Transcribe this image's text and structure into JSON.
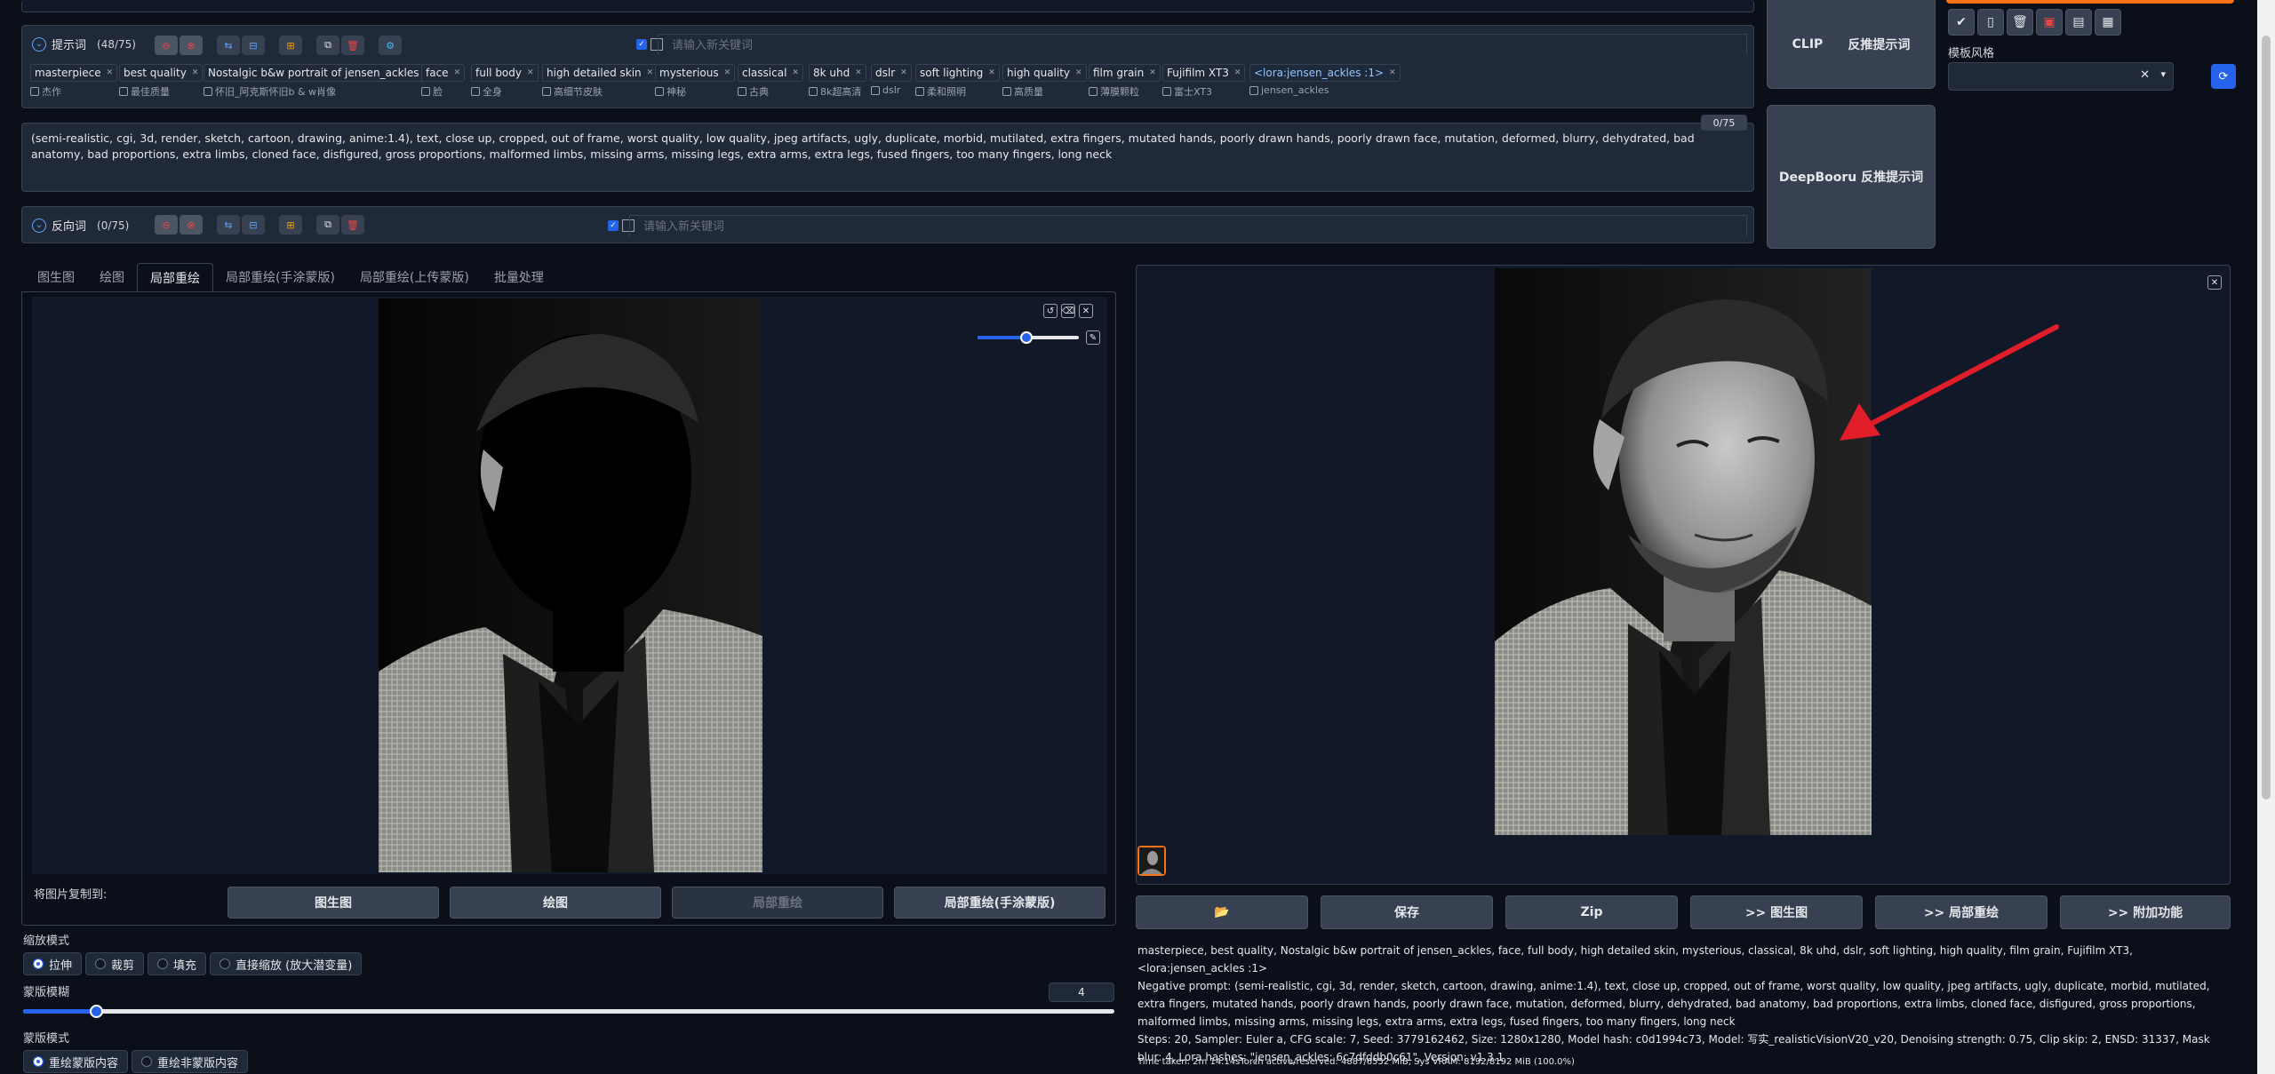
{
  "prompt": {
    "title": "提示词",
    "count": "(48/75)",
    "keyword_placeholder": "请输入新关键词",
    "tags": [
      {
        "en": "masterpiece",
        "zh": "杰作"
      },
      {
        "en": "best quality",
        "zh": "最佳质量"
      },
      {
        "en": "Nostalgic b&w portrait of jensen_ackles",
        "zh": "怀旧_阿克斯怀旧b & w肖像"
      },
      {
        "en": "face",
        "zh": "脸"
      },
      {
        "en": "full body",
        "zh": "全身"
      },
      {
        "en": "high detailed skin",
        "zh": "高细节皮肤"
      },
      {
        "en": "mysterious",
        "zh": "神秘"
      },
      {
        "en": "classical",
        "zh": "古典"
      },
      {
        "en": "8k uhd",
        "zh": "8k超高清"
      },
      {
        "en": "dslr",
        "zh": "dslr"
      },
      {
        "en": "soft lighting",
        "zh": "柔和照明"
      },
      {
        "en": "high quality",
        "zh": "高质量"
      },
      {
        "en": "film grain",
        "zh": "薄膜颗粒"
      },
      {
        "en": "Fujifilm XT3",
        "zh": "富士XT3"
      },
      {
        "en": "<lora:jensen_ackles :1>",
        "zh": "jensen_ackles"
      }
    ]
  },
  "negative": {
    "text": "(semi-realistic, cgi, 3d, render, sketch, cartoon, drawing, anime:1.4), text, close up, cropped, out of frame, worst quality, low quality, jpeg artifacts, ugly, duplicate, morbid, mutilated, extra fingers, mutated hands, poorly drawn hands, poorly drawn face, mutation, deformed, blurry, dehydrated, bad anatomy, bad proportions, extra limbs, cloned face, disfigured, gross proportions, malformed limbs, missing arms, missing legs, extra arms, extra legs, fused fingers, too many fingers, long neck",
    "counter": "0/75",
    "title": "反向词",
    "count": "(0/75)",
    "keyword_placeholder": "请输入新关键词"
  },
  "tabs": [
    "图生图",
    "绘图",
    "局部重绘",
    "局部重绘(手涂蒙版)",
    "局部重绘(上传蒙版)",
    "批量处理"
  ],
  "copy_to": {
    "label": "将图片复制到:",
    "buttons": [
      "图生图",
      "绘图",
      "局部重绘",
      "局部重绘(手涂蒙版)"
    ]
  },
  "resize_mode": {
    "label": "缩放模式",
    "options": [
      "拉伸",
      "裁剪",
      "填充",
      "直接缩放 (放大潜变量)"
    ],
    "selected": "拉伸"
  },
  "mask_blur": {
    "label": "蒙版模糊",
    "value": "4",
    "fraction": 0.067
  },
  "mask_mode": {
    "label": "蒙版模式",
    "options": [
      "重绘蒙版内容",
      "重绘非蒙版内容"
    ],
    "selected": "重绘蒙版内容"
  },
  "side": {
    "clip_label": "CLIP",
    "clip_reverse": "反推提示词",
    "deepbooru": "DeepBooru 反推提示词",
    "style_label": "模板风格"
  },
  "output": {
    "buttons": [
      "📂",
      "保存",
      "Zip",
      ">> 图生图",
      ">> 局部重绘",
      ">> 附加功能"
    ],
    "info_prompt": "masterpiece, best quality, Nostalgic b&w portrait of jensen_ackles, face, full body, high detailed skin, mysterious, classical, 8k uhd, dslr, soft lighting, high quality, film grain, Fujifilm XT3, <lora:jensen_ackles :1>",
    "info_negative": "Negative prompt: (semi-realistic, cgi, 3d, render, sketch, cartoon, drawing, anime:1.4), text, close up, cropped, out of frame, worst quality, low quality, jpeg artifacts, ugly, duplicate, morbid, mutilated, extra fingers, mutated hands, poorly drawn hands, poorly drawn face, mutation, deformed, blurry, dehydrated, bad anatomy, bad proportions, extra limbs, cloned face, disfigured, gross proportions, malformed limbs, missing arms, missing legs, extra arms, extra legs, fused fingers, too many fingers, long neck",
    "info_params": "Steps: 20, Sampler: Euler a, CFG scale: 7, Seed: 3779162462, Size: 1280x1280, Model hash: c0d1994c73, Model: 写实_realisticVisionV20_v20, Denoising strength: 0.75, Clip skip: 2, ENSD: 31337, Mask blur: 4, Lora hashes: \"jensen_ackles: 6c7dfddb0c61\", Version: v1.3.1",
    "time": "Time taken: 2m 14.14sTorch active/reserved: 4887/6552 MiB, Sys VRAM: 8192/8192 MiB (100.0%)"
  },
  "colors": {
    "accent": "#2563eb",
    "arrow": "#e11d2a",
    "bg": "#0b0f19",
    "orange": "#f97316"
  }
}
